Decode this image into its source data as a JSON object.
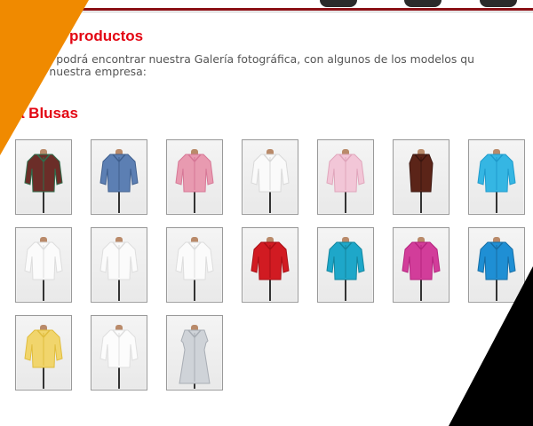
{
  "header": {
    "title": "productos"
  },
  "intro": {
    "line1": "ación podrá encontrar nuestra Galería fotográfica, con algunos de los modelos qu",
    "line2": "en nuestra empresa:"
  },
  "gallery": {
    "title": "a Blusas",
    "items": [
      {
        "name": "floral-blouse",
        "color": "#6b2d28",
        "accent": "#2f6d4c"
      },
      {
        "name": "denim-blouse",
        "color": "#5c7fb3",
        "accent": "#3f5f8e"
      },
      {
        "name": "pink-blouse",
        "color": "#e89ab0",
        "accent": "#d67796"
      },
      {
        "name": "white-blouse-short",
        "color": "#fafafa",
        "accent": "#d9d9d9"
      },
      {
        "name": "pink-stripe-blouse",
        "color": "#f2c6d7",
        "accent": "#e0a5bb"
      },
      {
        "name": "brown-vest-blouse",
        "color": "#5b2418",
        "accent": "#3b160f"
      },
      {
        "name": "turquoise-blouse",
        "color": "#35b6e3",
        "accent": "#1f9bcc"
      },
      {
        "name": "white-blouse-long",
        "color": "#fbfbfb",
        "accent": "#dddddd"
      },
      {
        "name": "white-tunic-blouse",
        "color": "#fbfbfb",
        "accent": "#dedede"
      },
      {
        "name": "white-blouse-three-quarter",
        "color": "#fbfbfb",
        "accent": "#dddddd"
      },
      {
        "name": "red-blouse",
        "color": "#d11b22",
        "accent": "#a80f15"
      },
      {
        "name": "turquoise-ruffle-blouse",
        "color": "#1ea7c9",
        "accent": "#14869f"
      },
      {
        "name": "magenta-ruffle-blouse",
        "color": "#d23d9a",
        "accent": "#b5247f"
      },
      {
        "name": "blue-blouse",
        "color": "#1f8fd4",
        "accent": "#176ea5"
      },
      {
        "name": "yellow-blouse",
        "color": "#f1d56c",
        "accent": "#e0bd3e"
      },
      {
        "name": "white-blouse-ruffle",
        "color": "#fcfcfc",
        "accent": "#dfdfdf"
      },
      {
        "name": "gray-dress",
        "color": "#cfd3d8",
        "accent": "#a8adb4"
      }
    ]
  },
  "colors": {
    "accent_red": "#e30613",
    "orange_corner": "#f08a00",
    "black_corner": "#000000"
  }
}
